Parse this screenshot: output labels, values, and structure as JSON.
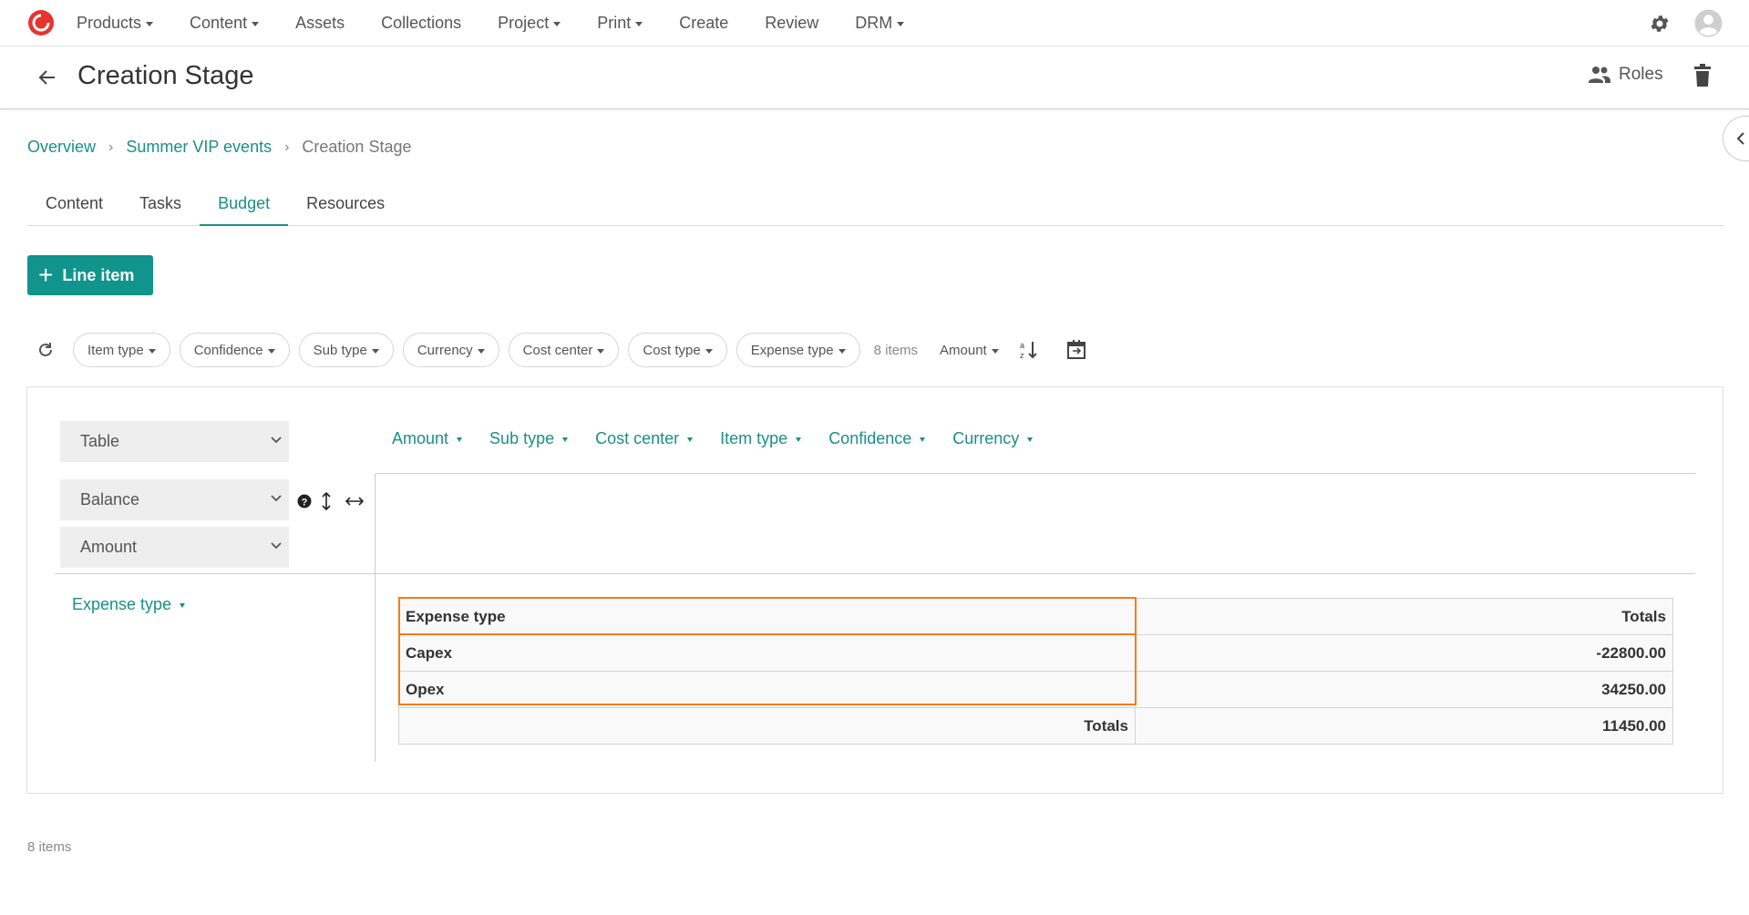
{
  "nav": {
    "items": [
      {
        "label": "Products",
        "dropdown": true
      },
      {
        "label": "Content",
        "dropdown": true
      },
      {
        "label": "Assets",
        "dropdown": false
      },
      {
        "label": "Collections",
        "dropdown": false
      },
      {
        "label": "Project",
        "dropdown": true
      },
      {
        "label": "Print",
        "dropdown": true
      },
      {
        "label": "Create",
        "dropdown": false
      },
      {
        "label": "Review",
        "dropdown": false
      },
      {
        "label": "DRM",
        "dropdown": true
      }
    ]
  },
  "header": {
    "title": "Creation Stage",
    "roles_label": "Roles"
  },
  "breadcrumb": {
    "items": [
      "Overview",
      "Summer VIP events"
    ],
    "current": "Creation Stage"
  },
  "tabs": [
    {
      "label": "Content",
      "active": false
    },
    {
      "label": "Tasks",
      "active": false
    },
    {
      "label": "Budget",
      "active": true
    },
    {
      "label": "Resources",
      "active": false
    }
  ],
  "add_button": {
    "label": "Line item"
  },
  "filters": {
    "chips": [
      "Item type",
      "Confidence",
      "Sub type",
      "Currency",
      "Cost center",
      "Cost type",
      "Expense type"
    ],
    "count": "8 items",
    "sort_label": "Amount"
  },
  "pivot": {
    "renderer": "Table",
    "aggregator": "Balance",
    "value_field": "Amount",
    "column_fields": [
      "Amount",
      "Sub type",
      "Cost center",
      "Item type",
      "Confidence",
      "Currency"
    ],
    "row_field": "Expense type",
    "table": {
      "header": [
        "Expense type",
        "Totals"
      ],
      "rows": [
        {
          "label": "Capex",
          "value": "-22800.00"
        },
        {
          "label": "Opex",
          "value": "34250.00"
        }
      ],
      "totals_label": "Totals",
      "totals_value": "11450.00"
    }
  },
  "footer": {
    "count": "8 items"
  },
  "colors": {
    "accent": "#11948b",
    "link": "#1a8f87",
    "highlight": "#f27d18",
    "logo": "#e8332e"
  }
}
